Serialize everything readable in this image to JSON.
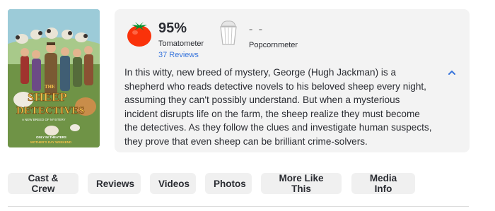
{
  "poster": {
    "title_line1": "THE",
    "title_line2": "SHEEP",
    "title_line3": "DETECTIVES",
    "tagline": "A NEW BREED OF MYSTERY",
    "release_line1": "ONLY IN THEATERS",
    "release_line2": "MOTHER'S DAY WEEKEND"
  },
  "scores": {
    "tomatometer_value": "95%",
    "tomatometer_label": "Tomatometer",
    "reviews_link": "37 Reviews",
    "popcornmeter_value": "- -",
    "popcornmeter_label": "Popcornmeter"
  },
  "synopsis": "In this witty, new breed of mystery, George (Hugh Jackman) is a shepherd who reads detective novels to his beloved sheep every night, assuming they can't possibly understand. But when a mysterious incident disrupts life on the farm, the sheep realize they must become the detectives. As they follow the clues and investigate human suspects, they prove that even sheep can be brilliant crime-solvers.",
  "nav": {
    "items": [
      "Cast & Crew",
      "Reviews",
      "Videos",
      "Photos",
      "More Like This",
      "Media Info"
    ]
  },
  "colors": {
    "accent_link": "#3976dc",
    "tomato_red": "#fa320a",
    "card_bg": "#f3f3f3",
    "chip_bg": "#f0f0f0"
  },
  "icons": {
    "tomato": "fresh-tomato-icon",
    "popcorn": "empty-popcorn-icon",
    "collapse": "chevron-up-icon"
  }
}
